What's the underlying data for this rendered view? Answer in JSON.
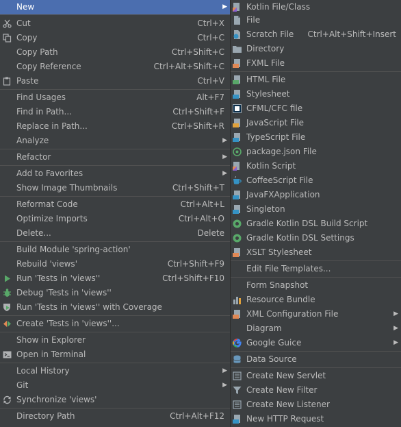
{
  "left_menu": {
    "new": "New",
    "cut": {
      "label": "Cut",
      "shortcut": "Ctrl+X"
    },
    "copy": {
      "label": "Copy",
      "shortcut": "Ctrl+C"
    },
    "copy_path": {
      "label": "Copy Path",
      "shortcut": "Ctrl+Shift+C"
    },
    "copy_reference": {
      "label": "Copy Reference",
      "shortcut": "Ctrl+Alt+Shift+C"
    },
    "paste": {
      "label": "Paste",
      "shortcut": "Ctrl+V"
    },
    "find_usages": {
      "label": "Find Usages",
      "shortcut": "Alt+F7"
    },
    "find_in_path": {
      "label": "Find in Path...",
      "shortcut": "Ctrl+Shift+F"
    },
    "replace_in_path": {
      "label": "Replace in Path...",
      "shortcut": "Ctrl+Shift+R"
    },
    "analyze": "Analyze",
    "refactor": "Refactor",
    "add_to_favorites": "Add to Favorites",
    "show_thumbnails": {
      "label": "Show Image Thumbnails",
      "shortcut": "Ctrl+Shift+T"
    },
    "reformat_code": {
      "label": "Reformat Code",
      "shortcut": "Ctrl+Alt+L"
    },
    "optimize_imports": {
      "label": "Optimize Imports",
      "shortcut": "Ctrl+Alt+O"
    },
    "delete": {
      "label": "Delete...",
      "shortcut": "Delete"
    },
    "build_module": {
      "label": "Build Module 'spring-action'"
    },
    "rebuild": {
      "label": "Rebuild 'views'",
      "shortcut": "Ctrl+Shift+F9"
    },
    "run_tests": {
      "label": "Run 'Tests in 'views''",
      "shortcut": "Ctrl+Shift+F10"
    },
    "debug_tests": {
      "label": "Debug 'Tests in 'views''"
    },
    "coverage_tests": {
      "label": "Run 'Tests in 'views'' with Coverage"
    },
    "create_tests": {
      "label": "Create 'Tests in 'views''..."
    },
    "show_in_explorer": "Show in Explorer",
    "open_in_terminal": "Open in Terminal",
    "local_history": "Local History",
    "git": "Git",
    "synchronize": "Synchronize 'views'",
    "directory_path": {
      "label": "Directory Path",
      "shortcut": "Ctrl+Alt+F12"
    }
  },
  "right_menu": {
    "kotlin_file": "Kotlin File/Class",
    "file": "File",
    "scratch_file": {
      "label": "Scratch File",
      "shortcut": "Ctrl+Alt+Shift+Insert"
    },
    "directory": "Directory",
    "fxml_file": "FXML File",
    "html_file": "HTML File",
    "stylesheet": "Stylesheet",
    "cfml_file": "CFML/CFC file",
    "javascript_file": "JavaScript File",
    "typescript_file": "TypeScript File",
    "package_json": "package.json File",
    "kotlin_script": "Kotlin Script",
    "coffeescript_file": "CoffeeScript File",
    "javafx_app": "JavaFXApplication",
    "singleton": "Singleton",
    "gradle_build": "Gradle Kotlin DSL Build Script",
    "gradle_settings": "Gradle Kotlin DSL Settings",
    "xslt": "XSLT Stylesheet",
    "edit_templates": "Edit File Templates...",
    "form_snapshot": "Form Snapshot",
    "resource_bundle": "Resource Bundle",
    "xml_config": "XML Configuration File",
    "diagram": "Diagram",
    "google_guice": "Google Guice",
    "data_source": "Data Source",
    "new_servlet": "Create New Servlet",
    "new_filter": "Create New Filter",
    "new_listener": "Create New Listener",
    "new_http_request": "New HTTP Request"
  },
  "colors": {
    "menu_bg": "#3c3f41",
    "selection": "#4b6eaf",
    "text": "#bbbbbb"
  }
}
